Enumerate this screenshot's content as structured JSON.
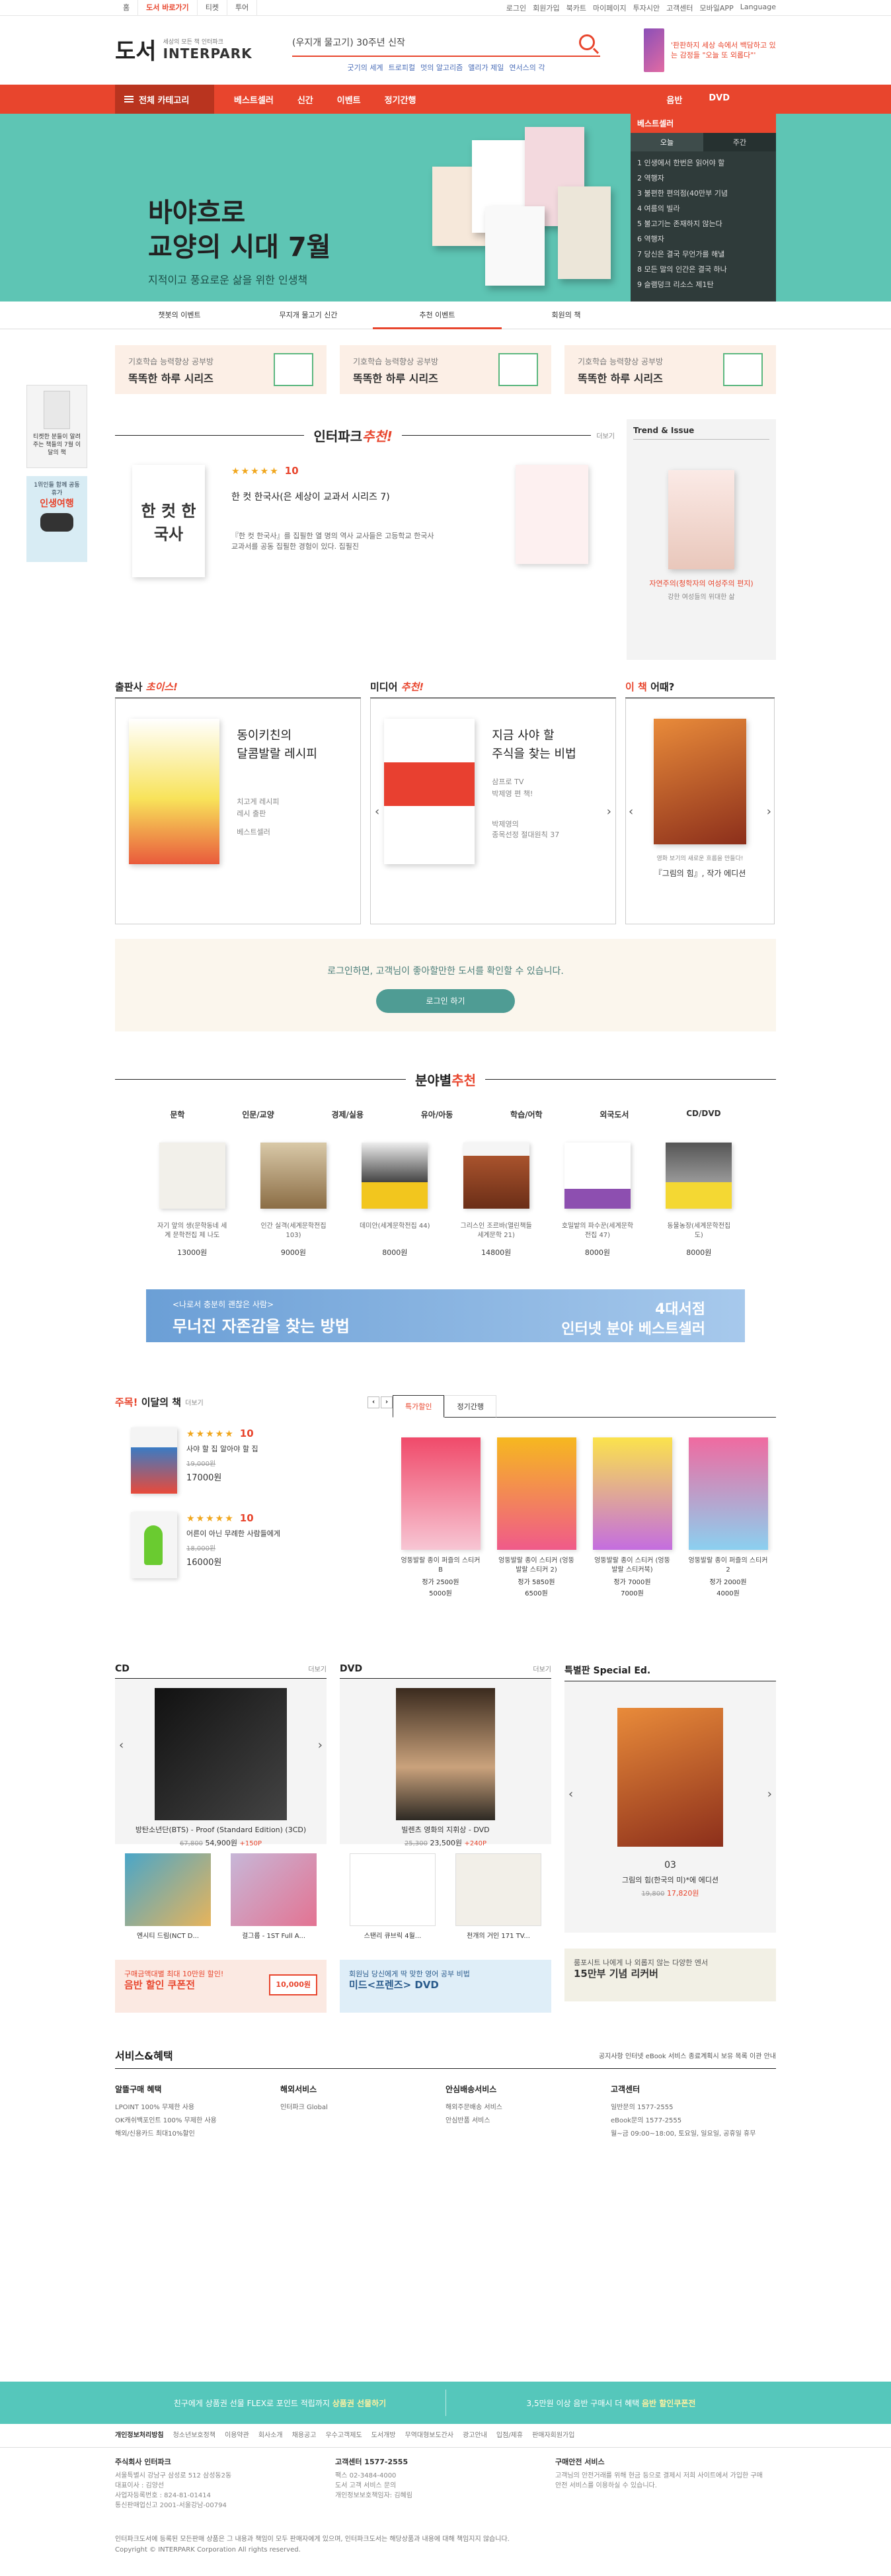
{
  "util": {
    "left": [
      "홈",
      "도서 바로가기",
      "티켓",
      "투어"
    ],
    "right": [
      "로그인",
      "회원가입",
      "북카트",
      "마이페이지",
      "투자시안",
      "고객센터",
      "모바일APP",
      "Language"
    ]
  },
  "header": {
    "logo_book": "도서",
    "logo_sub": "세상의 모든 책 인터파크",
    "logo_ip": "INTERPARK",
    "search_value": "(우지개 물고기) 30주년 신작",
    "keywords": [
      "굿기의 세계",
      "트로피컬",
      "멋의 알고리즘",
      "앨리가 제일",
      "연서스의 각"
    ],
    "ad_text": "'판판하지 세상 속에서 백담하고 있는 감정들 \"오늘 또 외롭다\"'"
  },
  "gnb": {
    "category": "전체 카테고리",
    "menu": [
      "베스트셀러",
      "신간",
      "이벤트",
      "정기간행"
    ],
    "right": [
      "음반",
      "DVD"
    ]
  },
  "hero": {
    "title": "바야흐로\n교양의 시대 7월",
    "sub": "지적이고 풍요로운 삶을 위한 인생책"
  },
  "best": {
    "head": "베스트셀러",
    "tabs": [
      "오늘",
      "주간"
    ],
    "items": [
      "1 인생에서 한번은 읽어야 할",
      "2 역행자",
      "3 불편한 편의점(40만부 기념",
      "4 여름의 빌라",
      "5 불고기는 존재하지 않는다",
      "6 역행자",
      "7 당신은 결국 무언가를 해낼",
      "8 모든 말의 인간은 결국 하나",
      "9 슬램덩크 리소스 제1탄"
    ]
  },
  "subtabs": [
    "챗봇의 이벤트",
    "무지개 물고기 신간",
    "추천 이벤트",
    "회원의 책"
  ],
  "side": {
    "b1": "티켓한 분들이 알려주는 책들의 7월 이달의 책",
    "b2": "1위인들 함께 공동휴가",
    "b2_big": "인생여행"
  },
  "banners": [
    {
      "small": "기호학습 능력향상 공부방",
      "large": "똑똑한 하루 시리즈"
    },
    {
      "small": "기호학습 능력향상 공부방",
      "large": "똑똑한 하루 시리즈"
    },
    {
      "small": "기호학습 능력향상 공부방",
      "large": "똑똑한 하루 시리즈"
    }
  ],
  "rec": {
    "title_plain": "인터파크",
    "title_em": "추천!",
    "more": "더보기",
    "cover_title": "한 컷 한국사",
    "stars": "★★★★★",
    "score": "10",
    "book_title": "한 컷 한국사(은 세상이 교과서 시리즈 7)",
    "desc": "『한 컷 한국사』를 집필한 열 명의 역사 교사들은 고등학교 한국사 교과서를 공동 집필한 경험이 있다. 집필진"
  },
  "trend": {
    "head": "Trend & Issue",
    "title": "자연주의(청학자의 여성주의 편지)",
    "desc": "강한 여성들의 위대한 삶"
  },
  "cols": [
    {
      "h_plain": "출판사",
      "h_em": "초이스!",
      "title": "동이키친의\n달콤발랄 레시피",
      "s1": "치고게 레시피",
      "s2": "레시 출판",
      "s3": "베스트셀러",
      "cover": "동이키친의 달콤발랄 레시피"
    },
    {
      "h_plain": "미디어",
      "h_em": "추천!",
      "title": "지금 사야 할\n주식을 찾는 비법",
      "s1": "삼프로 TV",
      "s2": "박제영 편 책!",
      "s3": "박제영의\n종목선정 절대원칙 37",
      "cover": "박제영의 종목선정 절대원칙 37"
    },
    {
      "h_plain": "이 책",
      "h_em": "어때?",
      "title": "",
      "s1": "영화 보기의 새로운 흐름을 만들다!",
      "s2": "『그림의 힘』, 작가 에디션"
    }
  ],
  "login": {
    "text": "로그인하면, 고객님이 좋아할만한 도서를 확인할 수 있습니다.",
    "button": "로그인 하기"
  },
  "field": {
    "title_plain": "분야별",
    "title_em": "추천",
    "tabs": [
      "문학",
      "인문/교양",
      "경제/실용",
      "유아/아동",
      "학습/어학",
      "외국도서",
      "CD/DVD"
    ],
    "books": [
      {
        "title": "자기 앞의 생(문학동네 세계 문학전집 제 나도",
        "price": "13000원"
      },
      {
        "title": "인간 실격(세계문학전집 103)",
        "price": "9000원"
      },
      {
        "title": "데미안(세계문학전집 44)",
        "price": "8000원"
      },
      {
        "title": "그리스인 조르바(열린책들 세계문학 21)",
        "price": "14800원"
      },
      {
        "title": "호밀밭의 파수꾼(세계문학전집 47)",
        "price": "8000원"
      },
      {
        "title": "동물농장(세계문학전집 도)",
        "price": "8000원"
      }
    ]
  },
  "blue": {
    "small": "<나로서 충분히 괜찮은 사람>",
    "large": "무너진 자존감을 찾는 방법",
    "r1": "4대서점",
    "r2": "인터넷 분야 베스트셀러"
  },
  "month": {
    "h_em": "주목!",
    "h_plain": "이달의 책",
    "more": "더보기",
    "items": [
      {
        "title": "사야 할 집 알아야 할 집",
        "orig": "19,000원",
        "price": "17000원",
        "score": "10"
      },
      {
        "title": "어른이 아닌 무례한 사람들에게",
        "orig": "18,000원",
        "price": "16000원",
        "score": "10"
      }
    ],
    "tabs": [
      "특가할인",
      "정기간행"
    ],
    "toys": [
      {
        "title": "엉뚱발랄 종이 퍼즐의 스티커 B",
        "orig": "정가 2500원",
        "price": "5000원"
      },
      {
        "title": "엉뚱발랄 종이 스티커 (엉뚱발랄 스티커 2)",
        "orig": "정가 5850원",
        "price": "6500원"
      },
      {
        "title": "엉뚱발랄 종이 스티커 (엉뚱발랄 스티커북)",
        "orig": "정가 7000원",
        "price": "7000원"
      },
      {
        "title": "엉뚱발랄 종이 퍼즐의 스티커 2",
        "orig": "정가 2000원",
        "price": "4000원"
      }
    ]
  },
  "media": [
    {
      "h": "CD",
      "more": "더보기",
      "title": "방탄소년단(BTS) - Proof (Standard Edition) (3CD)",
      "orig": "67,800",
      "price": "54,900원",
      "pt": "+150P",
      "sub": [
        "엔시티 드림(NCT D...",
        "걸그룹 - 1ST Full A..."
      ],
      "bnr_s": "구매금액대별 최대 10만원 할인!",
      "bnr_l": "음반 할인 쿠폰전",
      "bnr_tag": "10,000원"
    },
    {
      "h": "DVD",
      "more": "더보기",
      "title": "빌렌츠 영화의 지휘상 - DVD",
      "orig": "25,300",
      "price": "23,500원",
      "pt": "+240P",
      "sub": [
        "스탠리 큐브릭 4월...",
        "천개의 거인 171 TV..."
      ],
      "bnr_s": "회원님 당신에게 딱 맞한 영어 공부 비법",
      "bnr_l": "미드<프렌즈> DVD"
    },
    {
      "h": "특별판 Special Ed.",
      "title": "그림의 힘(한국의 미)*에 에디션",
      "num": "03",
      "orig": "19,800",
      "price": "17,820원",
      "bnr_s": "룸포시트 나에게 나 외롭지 않는 다양한 엔서",
      "bnr_l": "15만부 기념 리커버"
    }
  ],
  "svc": {
    "title": "서비스&혜택",
    "notice": "공지사항 인터넷 eBook 서비스 종료계획시 보유 목록 이관 안내",
    "cols": [
      {
        "h": "알뜰구매 혜택",
        "lines": [
          "LPOINT 100% 무제한 사용",
          "OK캐쉬백포인트 100% 무제한 사용",
          "해외/신용카드 최대10%할인"
        ]
      },
      {
        "h": "해외서비스",
        "lines": [
          "인터파크 Global"
        ]
      },
      {
        "h": "안심배송서비스",
        "lines": [
          "해외주문배송 서비스",
          "안심반품 서비스"
        ]
      },
      {
        "h": "고객센터",
        "lines": [
          "일반문의 1577-2555",
          "eBook문의 1577-2555",
          "월~금 09:00~18:00, 토요일, 일요일, 공휴일 휴무"
        ]
      }
    ]
  },
  "bottom_banner": {
    "left": "친구에게 상품권 선물 FLEX로 포인트 적립까지",
    "left_em": "상품권 선물하기",
    "right": "3,5만원 이상 음반 구매시 더 혜택",
    "right_em": "음반 할인쿠폰전"
  },
  "footer": {
    "links": [
      "개인정보처리방침",
      "청소년보호정책",
      "이용약관",
      "회사소개",
      "채용공고",
      "우수고객제도",
      "도서개방",
      "무역대형보도간사",
      "광고안내",
      "입점/제휴",
      "판매자회원가입"
    ],
    "info": [
      {
        "h": "주식회사 인터파크",
        "lines": [
          "서울특별시 강남구 삼성로 512 삼성동2동",
          "대표이사 : 김양선",
          "사업자등록번호 : 824-81-01414",
          "통신판매업신고 2001-서울강남-00794"
        ]
      },
      {
        "h": "고객센터 1577-2555",
        "lines": [
          "팩스 02-3484-4000",
          "도서 고객 서비스 문의",
          "개인정보보호책임자: 김혜림"
        ]
      },
      {
        "h": "구매안전 서비스",
        "lines": [
          "고객님의 안전거래를 위해 현금 등으로 결제시 저희 사이트에서 가입한 구매안전 서비스를 이용하실 수 있습니다."
        ]
      }
    ],
    "copy1": "인터파크도서에 등록된 모든판매 상품은 그 내용과 책임이 모두 판매자에게 있으며, 인터파크도서는 해당상품과 내용에 대해 책임지지 않습니다.",
    "copy2": "Copyright © INTERPARK Corporation All rights reserved."
  }
}
